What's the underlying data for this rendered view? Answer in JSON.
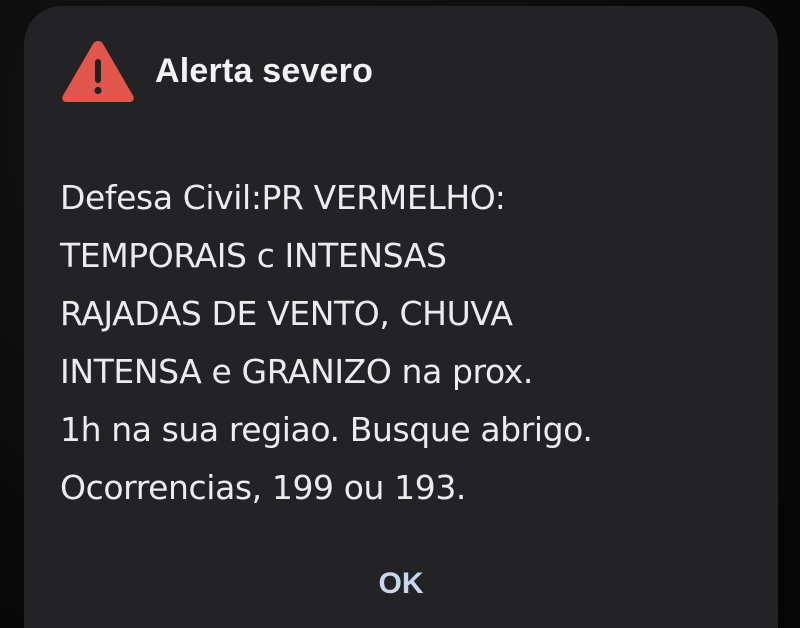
{
  "alert": {
    "title": "Alerta severo",
    "message": "Defesa Civil:PR VERMELHO:\nTEMPORAIS c INTENSAS\nRAJADAS DE VENTO, CHUVA\nINTENSA e GRANIZO na prox.\n1h na sua regiao. Busque abrigo.\nOcorrencias, 199 ou 193.",
    "ok_label": "OK",
    "icon": "warning-triangle-icon",
    "colors": {
      "dialog_background": "#232326",
      "icon_red": "#e2564b",
      "title_text": "#f2f2f2",
      "body_text": "#ececec",
      "button_text": "#c9d6ee"
    }
  }
}
